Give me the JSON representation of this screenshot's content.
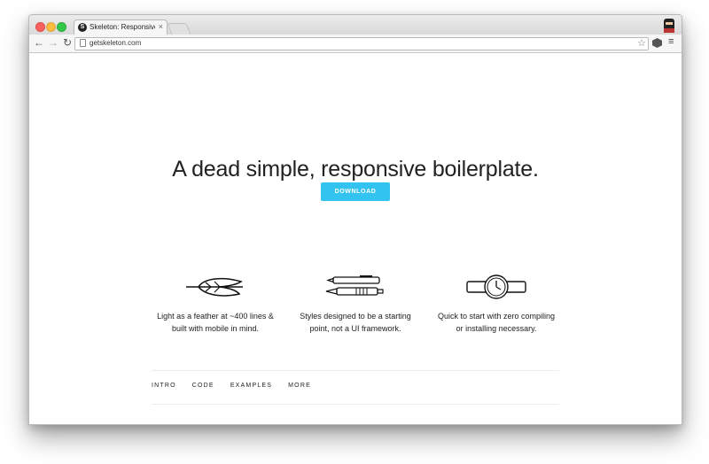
{
  "browser": {
    "tab_title": "Skeleton: Responsive CSS",
    "tab_favicon": "S",
    "url": "getskeleton.com",
    "icons": [
      "back-icon",
      "forward-icon",
      "reload-icon",
      "page-icon",
      "star-icon",
      "extension-icon",
      "menu-icon",
      "close-icon",
      "profile-avatar-icon"
    ]
  },
  "hero": {
    "title": "A dead simple, responsive boilerplate.",
    "download_label": "DOWNLOAD"
  },
  "features": [
    {
      "icon": "feather-icon",
      "line1": "Light as a feather at ~400 lines &",
      "line2": "built with mobile in mind."
    },
    {
      "icon": "pens-icon",
      "line1": "Styles designed to be a starting",
      "line2": "point, not a UI framework."
    },
    {
      "icon": "watch-icon",
      "line1": "Quick to start with zero compiling",
      "line2": "or installing necessary."
    }
  ],
  "nav": [
    "INTRO",
    "CODE",
    "EXAMPLES",
    "MORE"
  ],
  "colors": {
    "accent": "#33c3f0",
    "text": "#222222"
  }
}
